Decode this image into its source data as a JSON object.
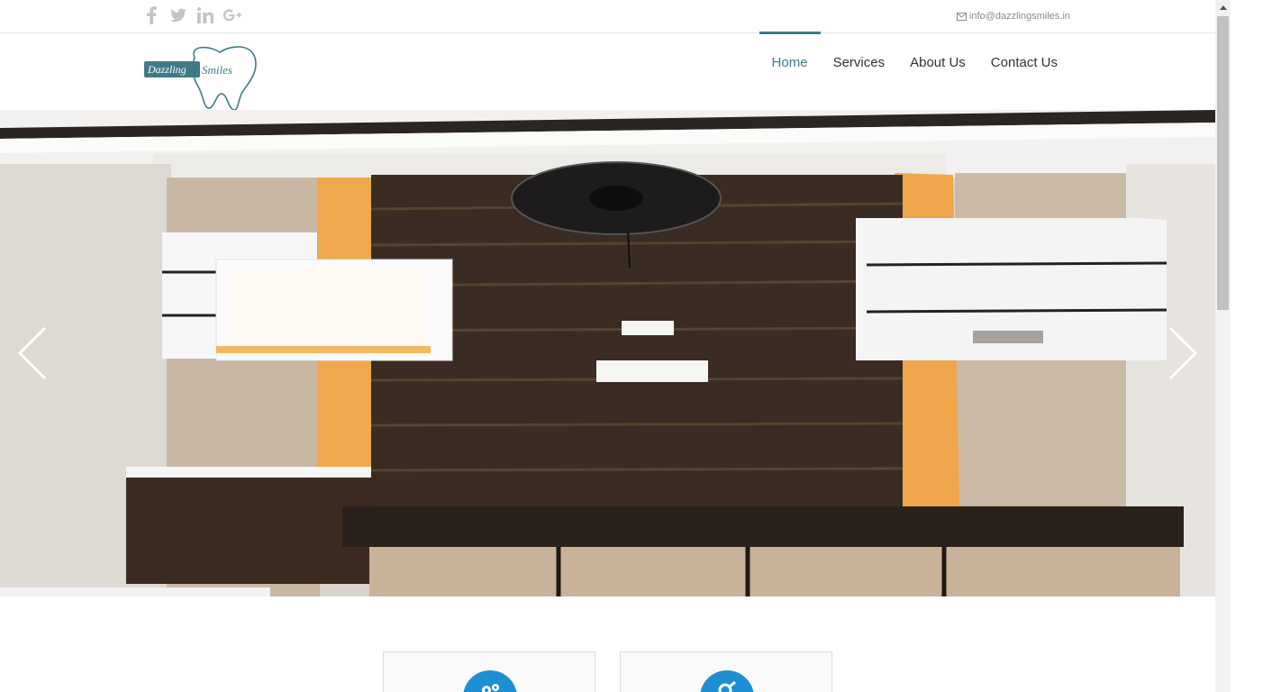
{
  "topbar": {
    "social": [
      {
        "icon": "facebook-icon"
      },
      {
        "icon": "twitter-icon"
      },
      {
        "icon": "linkedin-icon"
      },
      {
        "icon": "google-plus-icon"
      }
    ],
    "email": "info@dazzlingsmiles.in"
  },
  "logo": {
    "word1": "Dazzling",
    "word2": "Smiles"
  },
  "nav": {
    "home": "Home",
    "services": "Services",
    "about": "About Us",
    "contact": "Contact Us"
  },
  "colors": {
    "accent": "#3f7a89",
    "card_icon_bg": "#1f8fd4"
  },
  "slider": {
    "prev_icon": "chevron-left-icon",
    "next_icon": "chevron-right-icon"
  },
  "cards": [
    {
      "icon": "gears-icon"
    },
    {
      "icon": "search-icon"
    }
  ]
}
